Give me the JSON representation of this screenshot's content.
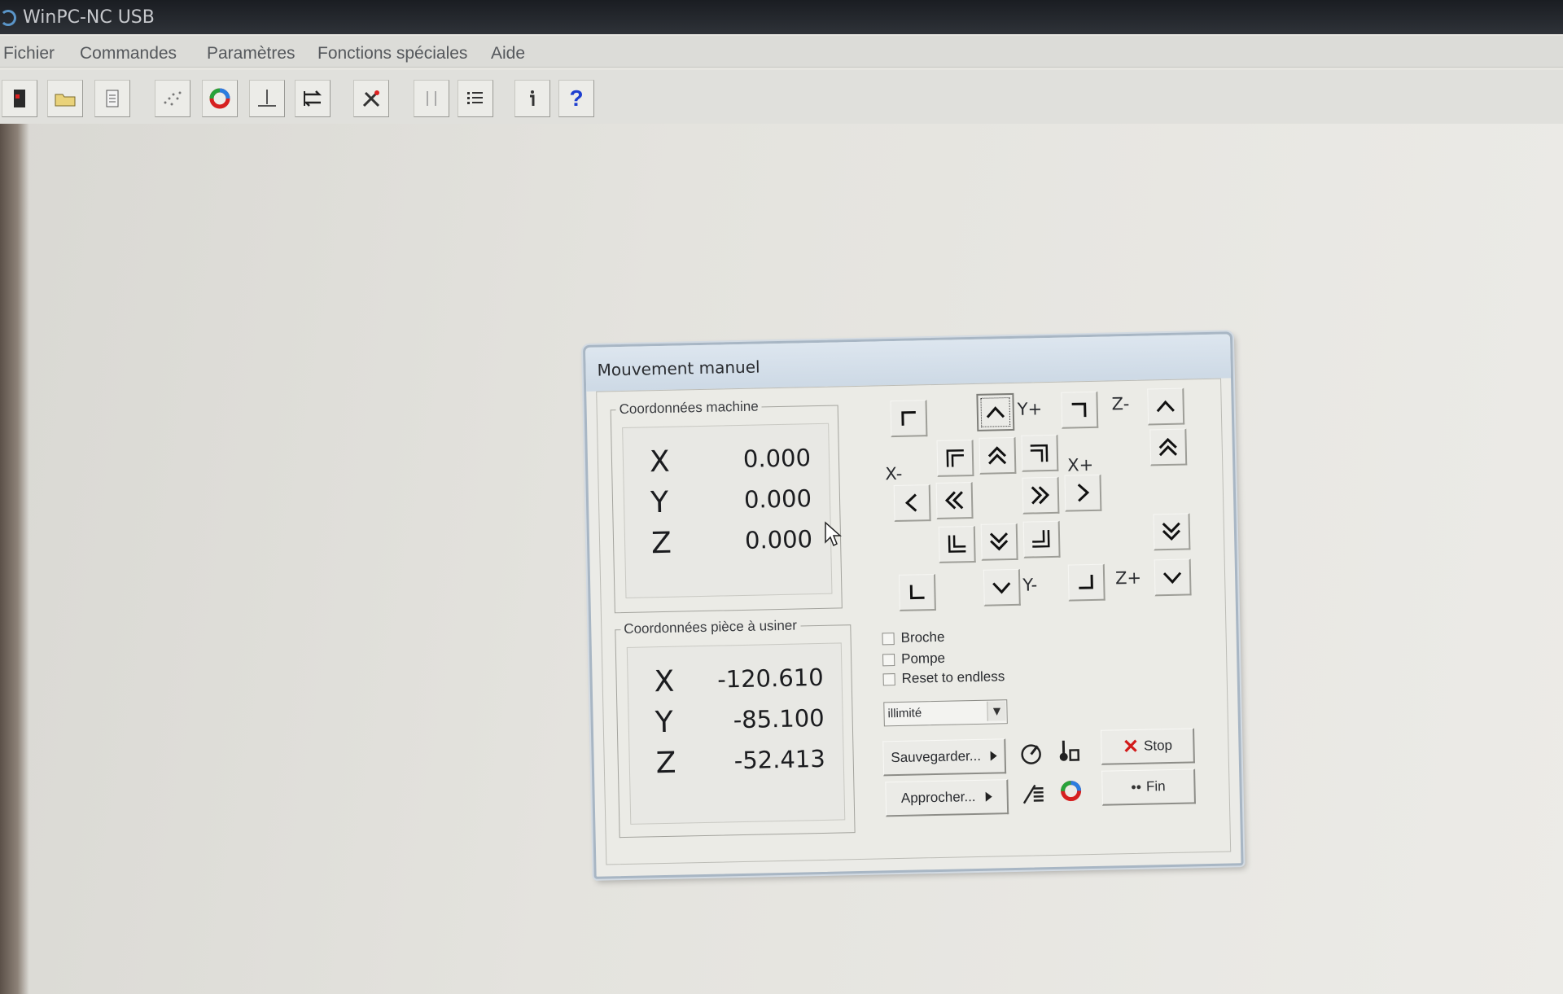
{
  "window": {
    "title": "WinPC-NC USB"
  },
  "menu": [
    "Fichier",
    "Commandes",
    "Paramètres",
    "Fonctions spéciales",
    "Aide"
  ],
  "toolbar": [
    {
      "icon": "exit-icon"
    },
    {
      "icon": "open-folder-icon"
    },
    {
      "icon": "document-icon"
    },
    {
      "icon": "points-icon"
    },
    {
      "icon": "start-ring-icon"
    },
    {
      "icon": "reference-icon"
    },
    {
      "icon": "swap-icon"
    },
    {
      "icon": "tools-icon"
    },
    {
      "icon": "param-icon"
    },
    {
      "icon": "list-icon"
    },
    {
      "icon": "info-icon"
    },
    {
      "icon": "help-icon",
      "glyph": "?"
    }
  ],
  "dialog": {
    "title": "Mouvement manuel",
    "machine": {
      "legend": "Coordonnées machine",
      "rows": [
        {
          "axis": "X",
          "value": "0.000"
        },
        {
          "axis": "Y",
          "value": "0.000"
        },
        {
          "axis": "Z",
          "value": "0.000"
        }
      ]
    },
    "workpiece": {
      "legend": "Coordonnées pièce à usiner",
      "rows": [
        {
          "axis": "X",
          "value": "-120.610"
        },
        {
          "axis": "Y",
          "value": "-85.100"
        },
        {
          "axis": "Z",
          "value": "-52.413"
        }
      ]
    },
    "jog_labels": {
      "yplus": "Y+",
      "yminus": "Y-",
      "xminus": "X-",
      "xplus": "X+",
      "zminus": "Z-",
      "zplus": "Z+"
    },
    "checkboxes": [
      {
        "label": "Broche",
        "checked": false
      },
      {
        "label": "Pompe",
        "checked": false
      },
      {
        "label": "Reset to endless",
        "checked": false
      }
    ],
    "speed_select": {
      "value": "illimité"
    },
    "buttons": {
      "save": "Sauvegarder...",
      "approach": "Approcher...",
      "stop": "Stop",
      "end": "Fin"
    }
  },
  "colors": {
    "stop_red": "#d21a1a",
    "titlebar": "#1f2227",
    "dialog_border": "#a8b6c4"
  }
}
